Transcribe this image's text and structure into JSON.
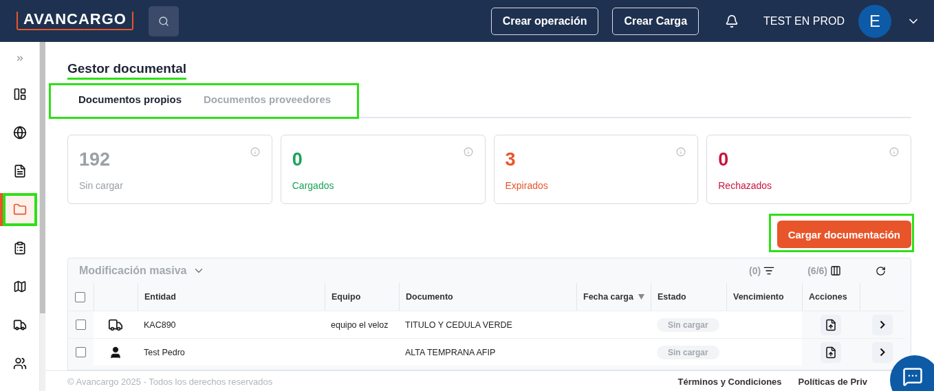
{
  "header": {
    "logo": "AVANCARGO",
    "buttons": [
      "Crear operación",
      "Crear Carga"
    ],
    "user": "TEST EN PROD",
    "avatar": "E"
  },
  "sidebar": {
    "items": [
      {
        "selected": false,
        "highlighted": false
      },
      {
        "selected": false,
        "highlighted": false
      },
      {
        "selected": false,
        "highlighted": false
      },
      {
        "selected": true,
        "highlighted": true
      },
      {
        "selected": false,
        "highlighted": false
      },
      {
        "selected": false,
        "highlighted": false
      },
      {
        "selected": false,
        "highlighted": false
      },
      {
        "selected": false,
        "highlighted": false
      }
    ]
  },
  "page_title": {
    "text": "Gestor documental",
    "highlighted": true
  },
  "tabs": {
    "highlighted": true,
    "items": [
      {
        "label": "Documentos propios",
        "selected": true
      },
      {
        "label": "Documentos proveedores",
        "selected": false
      }
    ]
  },
  "stats": [
    {
      "value": "192",
      "label": "Sin cargar",
      "color": "#9aa0a8"
    },
    {
      "value": "0",
      "label": "Cargados",
      "color": "#1aa35a"
    },
    {
      "value": "3",
      "label": "Expirados",
      "color": "#e8552a"
    },
    {
      "value": "0",
      "label": "Rechazados",
      "color": "#c8143c"
    }
  ],
  "upload_button": {
    "label": "Cargar documentación",
    "highlighted": true
  },
  "table": {
    "bulk_action": "Modificación masiva",
    "filter_count": "(0)",
    "columns_count": "(6/6)",
    "select_all_checked": false,
    "columns": [
      {
        "label": "Entidad",
        "sorted": false
      },
      {
        "label": "Equipo",
        "sorted": false
      },
      {
        "label": "Documento",
        "sorted": false
      },
      {
        "label": "Fecha carga",
        "sorted": true
      },
      {
        "label": "Estado",
        "sorted": false
      },
      {
        "label": "Vencimiento",
        "sorted": false
      },
      {
        "label": "Acciones",
        "sorted": false
      }
    ],
    "rows": [
      {
        "checked": false,
        "kind": "vehicle",
        "entity": "KAC890",
        "equipment": "equipo el veloz",
        "document": "TITULO Y CEDULA VERDE",
        "status": "Sin cargar"
      },
      {
        "checked": false,
        "kind": "person",
        "entity": "Test Pedro",
        "equipment": "",
        "document": "ALTA TEMPRANA AFIP",
        "status": "Sin cargar"
      }
    ]
  },
  "footer": {
    "copyright": "© Avancargo 2025 - Todos los derechos reservados",
    "links": [
      "Términos y Condiciones",
      "Políticas de Priv"
    ]
  }
}
